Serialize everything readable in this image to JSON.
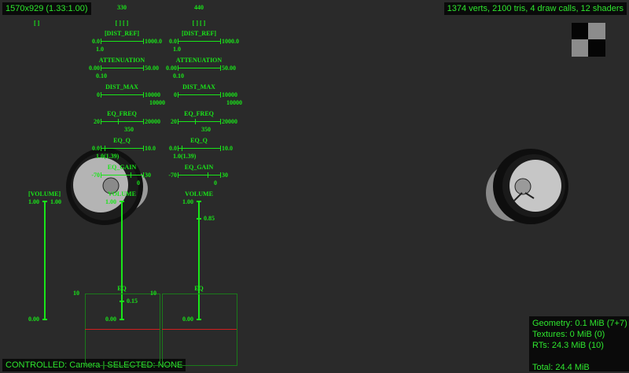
{
  "hud": {
    "resolution": "1570x929 (1.33:1.00)",
    "stats": "1374 verts, 2100 tris, 4 draw calls, 12 shaders",
    "status": "CONTROLLED: Camera | SELECTED: NONE",
    "memory": {
      "geometry": "Geometry: 0.1 MiB (7+7)",
      "textures": "Textures: 0 MiB (0)",
      "rts": "RTs: 24.3 MiB (10)",
      "total": "Total: 24.4 MiB"
    }
  },
  "overlay": {
    "left_bracket": "[ ]",
    "master_volume": {
      "label": "[VOLUME]",
      "max_left": "1.00",
      "max_right": "1.00",
      "min": "0.00"
    },
    "colors": {
      "green": "#19e619",
      "red_line": "#d21e1e",
      "background": "#2a2a2a"
    }
  },
  "sources": [
    {
      "id": "330",
      "brackets": "[ ]   [ ]",
      "params": [
        {
          "label": "[DIST_REF]",
          "min": "0.0",
          "max": "1000.0",
          "value": "1.0",
          "fraction": 0.001
        },
        {
          "label": "ATTENUATION",
          "min": "0.00",
          "max": "50.00",
          "value": "0.10",
          "fraction": 0.002
        },
        {
          "label": "DIST_MAX",
          "min": "0",
          "max": "10000",
          "value": "10000",
          "fraction": 1.0
        },
        {
          "label": "EQ_FREQ",
          "min": "20",
          "max": "20000",
          "value": "350",
          "fraction": 0.4
        },
        {
          "label": "EQ_Q",
          "min": "0.0",
          "max": "10.0",
          "value": "1.0(1.39)",
          "fraction": 0.1
        },
        {
          "label": "EQ_GAIN",
          "min": "-70",
          "max": "30",
          "value": "0",
          "fraction": 0.7
        }
      ],
      "volume": {
        "label": "VOLUME",
        "max": "1.00",
        "min": "0.00",
        "current": "0.15",
        "fraction": 0.15
      },
      "eq": {
        "label": "EQ",
        "left": "10"
      }
    },
    {
      "id": "440",
      "brackets": "[ ]   [ ]",
      "params": [
        {
          "label": "[DIST_REF]",
          "min": "0.0",
          "max": "1000.0",
          "value": "1.0",
          "fraction": 0.001
        },
        {
          "label": "ATTENUATION",
          "min": "0.00",
          "max": "50.00",
          "value": "0.10",
          "fraction": 0.002
        },
        {
          "label": "DIST_MAX",
          "min": "0",
          "max": "10000",
          "value": "10000",
          "fraction": 1.0
        },
        {
          "label": "EQ_FREQ",
          "min": "20",
          "max": "20000",
          "value": "350",
          "fraction": 0.4
        },
        {
          "label": "EQ_Q",
          "min": "0.0",
          "max": "10.0",
          "value": "1.0(1.39)",
          "fraction": 0.1
        },
        {
          "label": "EQ_GAIN",
          "min": "-70",
          "max": "30",
          "value": "0",
          "fraction": 0.7
        }
      ],
      "volume": {
        "label": "VOLUME",
        "max": "1.00",
        "min": "0.00",
        "current": "0.85",
        "fraction": 0.85
      },
      "eq": {
        "label": "EQ",
        "left": "10"
      }
    }
  ]
}
